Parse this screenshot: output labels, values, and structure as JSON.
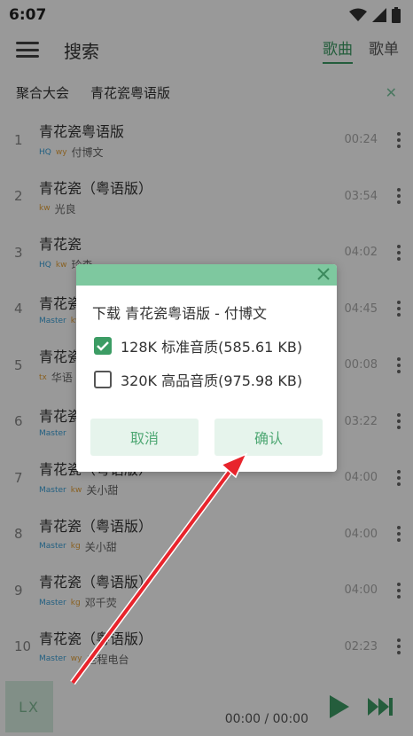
{
  "status": {
    "time": "6:07"
  },
  "header": {
    "title": "搜索",
    "tabs": [
      "歌曲",
      "歌单"
    ]
  },
  "search": {
    "source": "聚合大会",
    "query": "青花瓷粤语版"
  },
  "songs": [
    {
      "num": "1",
      "name": "青花瓷粤语版",
      "tags": [
        "HQ",
        "wy"
      ],
      "artist": "付博文",
      "duration": "00:24"
    },
    {
      "num": "2",
      "name": "青花瓷（粤语版）",
      "tags": [
        "kw"
      ],
      "artist": "光良",
      "duration": "03:54"
    },
    {
      "num": "3",
      "name": "青花瓷",
      "tags": [
        "HQ",
        "kw"
      ],
      "artist": "玲森",
      "duration": "04:02"
    },
    {
      "num": "4",
      "name": "青花瓷",
      "tags": [
        "Master",
        "kw"
      ],
      "artist": "",
      "duration": "04:45"
    },
    {
      "num": "5",
      "name": "青花瓷",
      "tags": [
        "tx"
      ],
      "artist": "华语",
      "duration": "00:08"
    },
    {
      "num": "6",
      "name": "青花瓷",
      "tags": [
        "Master"
      ],
      "artist": "",
      "duration": "03:22"
    },
    {
      "num": "7",
      "name": "青花瓷（粤语版）",
      "tags": [
        "Master",
        "kw"
      ],
      "artist": "关小甜",
      "duration": "04:00"
    },
    {
      "num": "8",
      "name": "青花瓷（粤语版）",
      "tags": [
        "Master",
        "kg"
      ],
      "artist": "关小甜",
      "duration": "04:00"
    },
    {
      "num": "9",
      "name": "青花瓷（粤语版）",
      "tags": [
        "Master",
        "kg"
      ],
      "artist": "邓千荧",
      "duration": "04:00"
    },
    {
      "num": "10",
      "name": "青花瓷（粤语版）",
      "tags": [
        "Master",
        "wy"
      ],
      "artist": "老程电台",
      "duration": "02:23"
    }
  ],
  "player": {
    "cover": "LX",
    "time": "00:00 / 00:00"
  },
  "dialog": {
    "title": "下载 青花瓷粤语版 - 付博文",
    "options": [
      {
        "label": "128K 标准音质(585.61 KB)",
        "checked": true
      },
      {
        "label": "320K 高品音质(975.98 KB)",
        "checked": false
      }
    ],
    "cancel": "取消",
    "confirm": "确认"
  },
  "colors": {
    "accent": "#3c9c64",
    "dialog_header": "#7ec89f",
    "arrow": "#e8242c"
  }
}
